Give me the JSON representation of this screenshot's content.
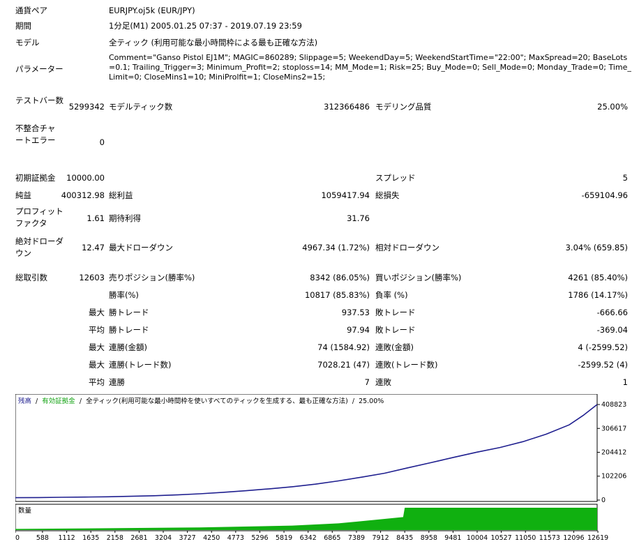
{
  "labels": {
    "symbol": "通貨ペア",
    "period": "期間",
    "model": "モデル",
    "parameters": "パラメーター",
    "bars": "テストバー数",
    "ticks": "モデルティック数",
    "quality": "モデリング品質",
    "mismatch": "不整合チャートエラー",
    "deposit": "初期証拠金",
    "spread": "スプレッド",
    "net_profit": "純益",
    "gross_profit": "総利益",
    "gross_loss": "総損失",
    "profit_factor": "プロフィットファクタ",
    "expected_payoff": "期待利得",
    "abs_drawdown": "絶対ドローダウン",
    "max_drawdown": "最大ドローダウン",
    "rel_drawdown": "相対ドローダウン",
    "total_trades": "総取引数",
    "short_positions": "売りポジション(勝率%)",
    "long_positions": "買いポジション(勝率%)",
    "win_rate": "勝率(%)",
    "loss_rate": "負率 (%)",
    "max": "最大",
    "avg": "平均",
    "win_trade": "勝トレード",
    "loss_trade": "敗トレード",
    "consec_wins_amount": "連勝(金額)",
    "consec_losses_amount": "連敗(金額)",
    "consec_wins_count": "連勝(トレード数)",
    "consec_losses_count": "連敗(トレード数)",
    "consec_wins": "連勝",
    "consec_losses": "連敗"
  },
  "values": {
    "symbol": "EURJPY.oj5k (EUR/JPY)",
    "period": "1分足(M1) 2005.01.25 07:37 - 2019.07.19 23:59",
    "model": "全ティック (利用可能な最小時間枠による最も正確な方法)",
    "parameters": "Comment=\"Ganso Pistol EJ1M\"; MAGIC=860289; Slippage=5; WeekendDay=5; WeekendStartTime=\"22:00\"; MaxSpread=20; BaseLots=0.1; Trailing_Trigger=3; Minimum_Profit=2; stoploss=14; MM_Mode=1; Risk=25; Buy_Mode=0; Sell_Mode=0; Monday_Trade=0; Time_Limit=0; CloseMins1=10; MiniProlfit=1; CloseMins2=15;",
    "bars": "5299342",
    "ticks": "312366486",
    "quality": "25.00%",
    "mismatch": "0",
    "deposit": "10000.00",
    "spread": "5",
    "net_profit": "400312.98",
    "gross_profit": "1059417.94",
    "gross_loss": "-659104.96",
    "profit_factor": "1.61",
    "expected_payoff": "31.76",
    "abs_drawdown": "12.47",
    "max_drawdown": "4967.34 (1.72%)",
    "rel_drawdown": "3.04% (659.85)",
    "total_trades": "12603",
    "short_positions": "8342 (86.05%)",
    "long_positions": "4261 (85.40%)",
    "win_rate": "10817 (85.83%)",
    "loss_rate": "1786 (14.17%)",
    "max_win": "937.53",
    "max_loss": "-666.66",
    "avg_win": "97.94",
    "avg_loss": "-369.04",
    "consec_wins_amount": "74 (1584.92)",
    "consec_losses_amount": "4 (-2599.52)",
    "consec_wins_count": "7028.21 (47)",
    "consec_losses_count": "-2599.52 (4)",
    "avg_consec_wins": "7",
    "avg_consec_losses": "1"
  },
  "chart_data": {
    "type": "line",
    "legend": {
      "balance": "残高",
      "sep1": "/",
      "equity": "有効証拠金",
      "sep2": "/",
      "model_text": "全ティック(利用可能な最小時間枠を使いすべてのティックを生成する、最も正確な方法)",
      "sep3": "/",
      "quality": "25.00%"
    },
    "volume_label": "数量",
    "y_ticks": [
      408823,
      306617,
      204412,
      102206,
      0
    ],
    "ylim": [
      0,
      408823
    ],
    "x_ticks": [
      0,
      588,
      1112,
      1635,
      2158,
      2681,
      3204,
      3727,
      4250,
      4773,
      5296,
      5819,
      6342,
      6865,
      7389,
      7912,
      8435,
      8958,
      9481,
      10004,
      10527,
      11050,
      11573,
      12096,
      12619
    ],
    "xlim": [
      0,
      12603
    ],
    "series": [
      {
        "values": [
          [
            0,
            10000
          ],
          [
            500,
            10800
          ],
          [
            1000,
            11800
          ],
          [
            1500,
            12800
          ],
          [
            2000,
            14000
          ],
          [
            2500,
            16000
          ],
          [
            3000,
            18500
          ],
          [
            3500,
            22000
          ],
          [
            4000,
            27000
          ],
          [
            4500,
            33000
          ],
          [
            5000,
            40000
          ],
          [
            5500,
            48000
          ],
          [
            6000,
            57000
          ],
          [
            6500,
            68000
          ],
          [
            7000,
            82000
          ],
          [
            7500,
            98000
          ],
          [
            8000,
            115000
          ],
          [
            8500,
            138000
          ],
          [
            9000,
            160000
          ],
          [
            9500,
            183000
          ],
          [
            10000,
            205000
          ],
          [
            10500,
            225000
          ],
          [
            11000,
            250000
          ],
          [
            11500,
            282000
          ],
          [
            12000,
            322000
          ],
          [
            12300,
            362000
          ],
          [
            12603,
            408823
          ]
        ],
        "color": "#1f1f8f"
      }
    ],
    "volume_values": [
      [
        0,
        0.05
      ],
      [
        2000,
        0.08
      ],
      [
        4000,
        0.12
      ],
      [
        6000,
        0.2
      ],
      [
        7000,
        0.3
      ],
      [
        8000,
        0.5
      ],
      [
        8400,
        0.58
      ],
      [
        8435,
        1.0
      ],
      [
        12603,
        1.0
      ]
    ],
    "colors": {
      "balance_legend": "#1f1f8f",
      "equity_legend": "#13a313",
      "volume": "#10b010",
      "text": "#000000"
    }
  }
}
